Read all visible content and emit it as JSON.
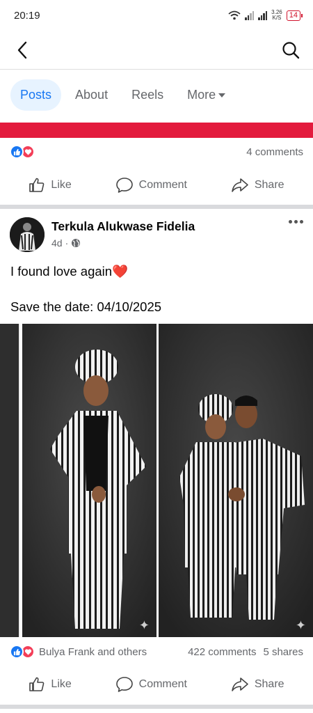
{
  "status": {
    "time": "20:19",
    "speed_top": "3.26",
    "speed_bottom": "K/S",
    "battery": "14"
  },
  "tabs": [
    {
      "label": "Posts"
    },
    {
      "label": "About"
    },
    {
      "label": "Reels"
    },
    {
      "label": "More"
    }
  ],
  "prev_post": {
    "comments": "4 comments",
    "actions": {
      "like": "Like",
      "comment": "Comment",
      "share": "Share"
    }
  },
  "post": {
    "author": "Terkula Alukwase Fidelia",
    "time": "4d",
    "line1": "I found love again",
    "line1_emoji": "❤️",
    "line2": "Save the date: 04/10/2025",
    "reactions_text": "Bulya Frank and others",
    "comments": "422 comments",
    "shares": "5 shares",
    "actions": {
      "like": "Like",
      "comment": "Comment",
      "share": "Share"
    }
  },
  "colors": {
    "accent": "#1877f2",
    "love": "#f33e58",
    "banner": "#e31b3d"
  },
  "icons": [
    "back-arrow-icon",
    "search-icon",
    "like-icon",
    "comment-icon",
    "share-icon",
    "globe-icon",
    "more-options-icon"
  ]
}
